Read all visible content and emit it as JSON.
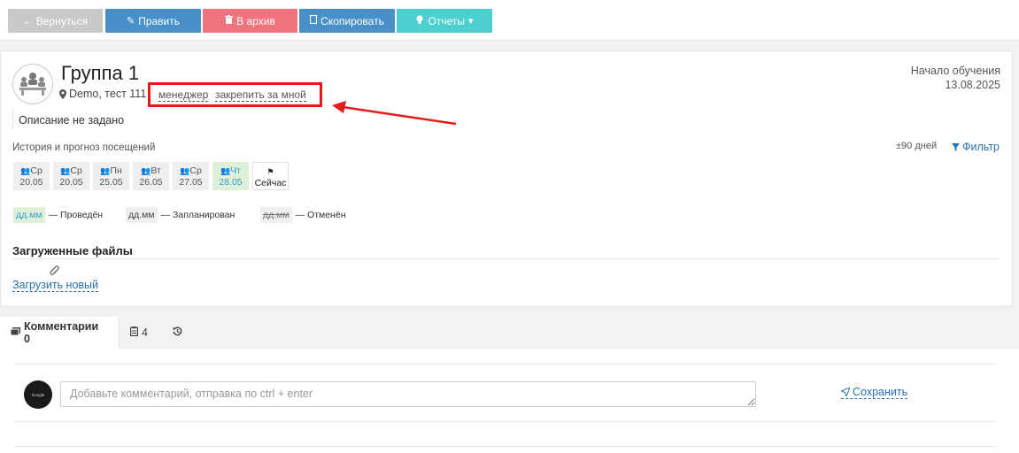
{
  "toolbar": {
    "back_label": "Вернуться",
    "edit_label": "Править",
    "archive_label": "В архив",
    "copy_label": "Скопировать",
    "reports_label": "Отчеты",
    "colors": {
      "back": "#c9c9c9",
      "edit": "#4a90c8",
      "archive": "#f0747d",
      "copy": "#4a90c8",
      "reports": "#4dcfcf"
    }
  },
  "group": {
    "title": "Группа 1",
    "location": "Demo, тест 111",
    "manager_label": "менеджер",
    "assign_label": "закрепить за мной",
    "description": "Описание не задано",
    "start_label": "Начало обучения",
    "start_date": "13.08.2025"
  },
  "attendance": {
    "title": "История и прогноз посещений",
    "range": "±90 дней",
    "filter_label": "Фильтр",
    "cells": [
      {
        "day": "Ср",
        "date": "20.05",
        "state": "planned"
      },
      {
        "day": "Ср",
        "date": "20.05",
        "state": "planned"
      },
      {
        "day": "Пн",
        "date": "25.05",
        "state": "planned"
      },
      {
        "day": "Вт",
        "date": "26.05",
        "state": "planned"
      },
      {
        "day": "Ср",
        "date": "27.05",
        "state": "planned"
      },
      {
        "day": "Чт",
        "date": "28.05",
        "state": "done"
      }
    ],
    "now_label": "Сейчас",
    "legend": {
      "done_sample": "дд.мм",
      "done_text": "— Проведён",
      "planned_sample": "дд.мм",
      "planned_text": "— Запланирован",
      "canceled_sample": "дд.мм",
      "canceled_text": "— Отменён"
    }
  },
  "files": {
    "title": "Загруженные файлы",
    "upload_label": "Загрузить новый"
  },
  "tabs": {
    "comments_label": "Комментарии 0",
    "tasks_count": "4"
  },
  "comment_form": {
    "avatar_text": "Google",
    "placeholder": "Добавьте комментарий, отправка по ctrl + enter",
    "save_label": "Сохранить"
  }
}
